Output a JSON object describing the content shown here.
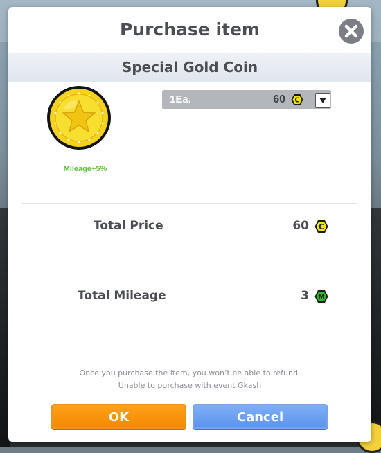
{
  "dialog": {
    "title": "Purchase item",
    "item_name": "Special Gold Coin",
    "mileage_note": "Mileage+5%",
    "quantity": {
      "label": "1Ea.",
      "price": "60",
      "currency_icon": "c-coin-icon",
      "arrow_icon": "triangle-down-icon"
    },
    "total_price": {
      "label": "Total Price",
      "value": "60",
      "currency_icon": "c-coin-icon"
    },
    "total_mileage": {
      "label": "Total Mileage",
      "value": "3",
      "currency_icon": "m-mileage-icon"
    },
    "notice": [
      "Once you purchase the item, you won’t be able to refund.",
      "Unable to purchase with event Gkash"
    ],
    "ok_label": "OK",
    "cancel_label": "Cancel"
  },
  "colors": {
    "ok_button": "#F28A00",
    "cancel_button": "#6C9EF0",
    "mileage_text": "#5FBF3D",
    "coin_badge_fill": "#F2E600",
    "mileage_badge_fill": "#2FB82A"
  }
}
